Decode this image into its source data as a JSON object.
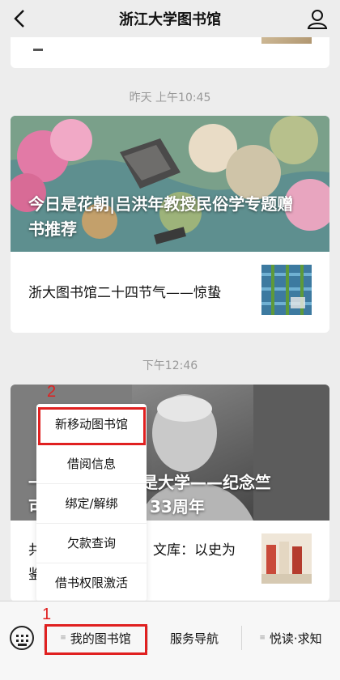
{
  "header": {
    "title": "浙江大学图书馆"
  },
  "feed": {
    "timestamp_1": "昨天 上午10:45",
    "article_1": {
      "title": "今日是花朝|吕洪年教授民俗学专题赠书推荐"
    },
    "article_2": {
      "title": "浙大图书馆二十四节气——惊蛰"
    },
    "timestamp_2": "下午12:46",
    "article_3": {
      "title_line1": "一……………就是大学——纪念竺",
      "title_left_fragment": "可",
      "title_right_fragment": "33周年",
      "sub_left_1": "共",
      "sub_right": "文库：以史为",
      "sub_left_2": "鉴"
    }
  },
  "popup_menu": {
    "items": [
      "新移动图书馆",
      "借阅信息",
      "绑定/解绑",
      "欠款查询",
      "借书权限激活"
    ]
  },
  "bottom_menu": {
    "tabs": [
      "我的图书馆",
      "服务导航",
      "悦读·求知"
    ]
  },
  "annotations": {
    "marker_1": "1",
    "marker_2": "2",
    "color": "#e02020"
  }
}
